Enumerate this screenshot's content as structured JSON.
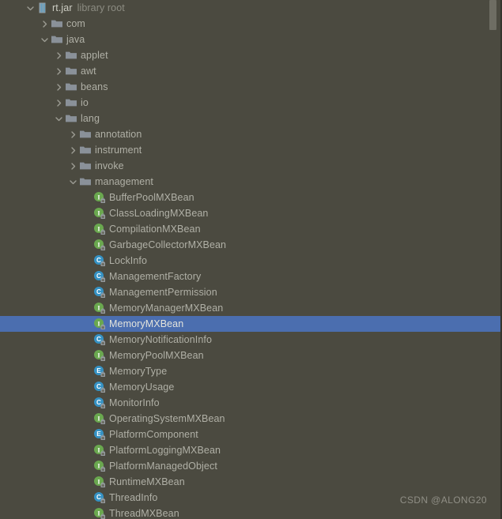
{
  "colors": {
    "background": "#4b4a40",
    "selection": "#4b6eaf",
    "text": "#b0b0a6",
    "text_dim": "#8c8c82",
    "folder": "#8a9199",
    "interface": "#6aa84f",
    "class": "#3592c4",
    "enum": "#3592c4",
    "scrollbar": "#6e6d63"
  },
  "watermark": "CSDN @ALONG20",
  "scrollbar": {
    "thumb_top": 0,
    "thumb_height": 38
  },
  "tree": {
    "rows": [
      {
        "depth": 1,
        "twisty": "expanded",
        "icon": "jar-icon",
        "label": "rt.jar",
        "suffix": "library root",
        "selected": false
      },
      {
        "depth": 2,
        "twisty": "collapsed",
        "icon": "folder-icon",
        "label": "com",
        "suffix": "",
        "selected": false
      },
      {
        "depth": 2,
        "twisty": "expanded",
        "icon": "folder-icon",
        "label": "java",
        "suffix": "",
        "selected": false
      },
      {
        "depth": 3,
        "twisty": "collapsed",
        "icon": "folder-icon",
        "label": "applet",
        "suffix": "",
        "selected": false
      },
      {
        "depth": 3,
        "twisty": "collapsed",
        "icon": "folder-icon",
        "label": "awt",
        "suffix": "",
        "selected": false
      },
      {
        "depth": 3,
        "twisty": "collapsed",
        "icon": "folder-icon",
        "label": "beans",
        "suffix": "",
        "selected": false
      },
      {
        "depth": 3,
        "twisty": "collapsed",
        "icon": "folder-icon",
        "label": "io",
        "suffix": "",
        "selected": false
      },
      {
        "depth": 3,
        "twisty": "expanded",
        "icon": "folder-icon",
        "label": "lang",
        "suffix": "",
        "selected": false
      },
      {
        "depth": 4,
        "twisty": "collapsed",
        "icon": "folder-icon",
        "label": "annotation",
        "suffix": "",
        "selected": false
      },
      {
        "depth": 4,
        "twisty": "collapsed",
        "icon": "folder-icon",
        "label": "instrument",
        "suffix": "",
        "selected": false
      },
      {
        "depth": 4,
        "twisty": "collapsed",
        "icon": "folder-icon",
        "label": "invoke",
        "suffix": "",
        "selected": false
      },
      {
        "depth": 4,
        "twisty": "expanded",
        "icon": "folder-icon",
        "label": "management",
        "suffix": "",
        "selected": false
      },
      {
        "depth": 5,
        "twisty": "none",
        "icon": "interface-icon",
        "label": "BufferPoolMXBean",
        "suffix": "",
        "selected": false
      },
      {
        "depth": 5,
        "twisty": "none",
        "icon": "interface-icon",
        "label": "ClassLoadingMXBean",
        "suffix": "",
        "selected": false
      },
      {
        "depth": 5,
        "twisty": "none",
        "icon": "interface-icon",
        "label": "CompilationMXBean",
        "suffix": "",
        "selected": false
      },
      {
        "depth": 5,
        "twisty": "none",
        "icon": "interface-icon",
        "label": "GarbageCollectorMXBean",
        "suffix": "",
        "selected": false
      },
      {
        "depth": 5,
        "twisty": "none",
        "icon": "class-icon",
        "label": "LockInfo",
        "suffix": "",
        "selected": false
      },
      {
        "depth": 5,
        "twisty": "none",
        "icon": "class-icon",
        "label": "ManagementFactory",
        "suffix": "",
        "selected": false
      },
      {
        "depth": 5,
        "twisty": "none",
        "icon": "class-icon",
        "label": "ManagementPermission",
        "suffix": "",
        "selected": false
      },
      {
        "depth": 5,
        "twisty": "none",
        "icon": "interface-icon",
        "label": "MemoryManagerMXBean",
        "suffix": "",
        "selected": false
      },
      {
        "depth": 5,
        "twisty": "none",
        "icon": "interface-icon",
        "label": "MemoryMXBean",
        "suffix": "",
        "selected": true
      },
      {
        "depth": 5,
        "twisty": "none",
        "icon": "class-icon",
        "label": "MemoryNotificationInfo",
        "suffix": "",
        "selected": false
      },
      {
        "depth": 5,
        "twisty": "none",
        "icon": "interface-icon",
        "label": "MemoryPoolMXBean",
        "suffix": "",
        "selected": false
      },
      {
        "depth": 5,
        "twisty": "none",
        "icon": "enum-icon",
        "label": "MemoryType",
        "suffix": "",
        "selected": false
      },
      {
        "depth": 5,
        "twisty": "none",
        "icon": "class-icon",
        "label": "MemoryUsage",
        "suffix": "",
        "selected": false
      },
      {
        "depth": 5,
        "twisty": "none",
        "icon": "class-icon",
        "label": "MonitorInfo",
        "suffix": "",
        "selected": false
      },
      {
        "depth": 5,
        "twisty": "none",
        "icon": "interface-icon",
        "label": "OperatingSystemMXBean",
        "suffix": "",
        "selected": false
      },
      {
        "depth": 5,
        "twisty": "none",
        "icon": "enum-icon",
        "label": "PlatformComponent",
        "suffix": "",
        "selected": false
      },
      {
        "depth": 5,
        "twisty": "none",
        "icon": "interface-icon",
        "label": "PlatformLoggingMXBean",
        "suffix": "",
        "selected": false
      },
      {
        "depth": 5,
        "twisty": "none",
        "icon": "interface-icon",
        "label": "PlatformManagedObject",
        "suffix": "",
        "selected": false
      },
      {
        "depth": 5,
        "twisty": "none",
        "icon": "interface-icon",
        "label": "RuntimeMXBean",
        "suffix": "",
        "selected": false
      },
      {
        "depth": 5,
        "twisty": "none",
        "icon": "class-icon",
        "label": "ThreadInfo",
        "suffix": "",
        "selected": false
      },
      {
        "depth": 5,
        "twisty": "none",
        "icon": "interface-icon",
        "label": "ThreadMXBean",
        "suffix": "",
        "selected": false
      }
    ]
  }
}
